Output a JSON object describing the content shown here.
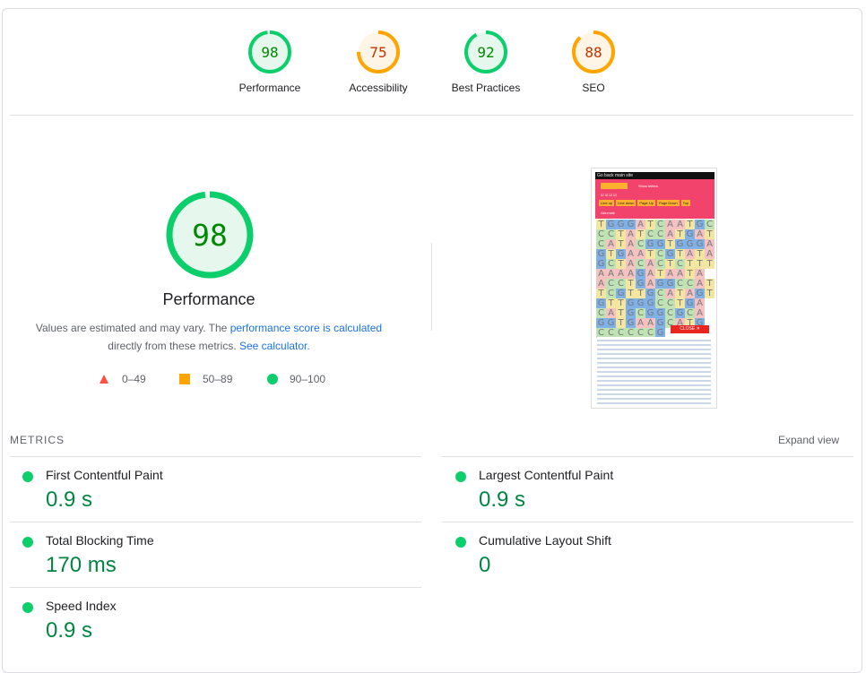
{
  "colors": {
    "pass": "#0cce6b",
    "pass_text": "#008800",
    "average": "#ffa400",
    "average_text": "#c33300",
    "fail": "#ff4e42"
  },
  "gauges": [
    {
      "score": 98,
      "label": "Performance",
      "level": "pass"
    },
    {
      "score": 75,
      "label": "Accessibility",
      "level": "average"
    },
    {
      "score": 92,
      "label": "Best Practices",
      "level": "pass"
    },
    {
      "score": 88,
      "label": "SEO",
      "level": "average"
    }
  ],
  "main": {
    "score": 98,
    "title": "Performance",
    "desc_prefix": "Values are estimated and may vary. The",
    "desc_link1": "performance score is calculated",
    "desc_mid": "directly from these metrics.",
    "desc_link2": "See calculator."
  },
  "legend": [
    {
      "range": "0–49",
      "shape": "triangle-icon"
    },
    {
      "range": "50–89",
      "shape": "square-icon"
    },
    {
      "range": "90–100",
      "shape": "circle-icon"
    }
  ],
  "screenshot": {
    "top_bar_text": "Go back main site",
    "buttons": [
      "Line up",
      "Line down",
      "Page Up",
      "Page Down",
      "Top"
    ],
    "checkbox1": "Show letters",
    "checkbox2": "Alternate",
    "close_label": "CLOSE ✕",
    "grid_rows": [
      "TGGGATCAATGC",
      "CCTATCCATGAT",
      "CATACGGTGGGA",
      "GTGAATCGTATA",
      "GCTACACTCTTT",
      "AAAAGATAATA",
      "ACCTGAGGCCAT",
      "TCGTTGCATAGT",
      "GTTGGGCCTGA",
      "CATGCGGCGCA",
      "GGTGAAGCATG",
      "CCCCCCG"
    ]
  },
  "metrics": {
    "header": "METRICS",
    "expand": "Expand view",
    "items": [
      {
        "name": "First Contentful Paint",
        "value": "0.9 s"
      },
      {
        "name": "Largest Contentful Paint",
        "value": "0.9 s"
      },
      {
        "name": "Total Blocking Time",
        "value": "170 ms"
      },
      {
        "name": "Cumulative Layout Shift",
        "value": "0"
      },
      {
        "name": "Speed Index",
        "value": "0.9 s"
      }
    ]
  }
}
